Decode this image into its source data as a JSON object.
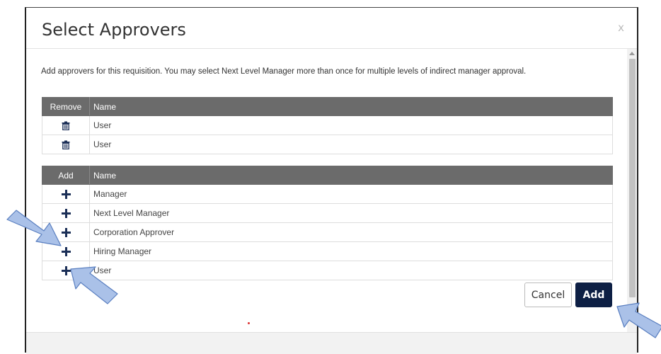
{
  "modal": {
    "title": "Select Approvers",
    "close_label": "x",
    "intro": "Add approvers for this requisition. You may select Next Level Manager more than once for multiple levels of indirect manager approval."
  },
  "selected_table": {
    "headers": [
      "Remove",
      "Name"
    ],
    "rows": [
      {
        "name": "User"
      },
      {
        "name": "User"
      }
    ]
  },
  "available_table": {
    "headers": [
      "Add",
      "Name"
    ],
    "rows": [
      {
        "name": "Manager"
      },
      {
        "name": "Next Level Manager"
      },
      {
        "name": "Corporation Approver"
      },
      {
        "name": "Hiring Manager"
      },
      {
        "name": "User"
      }
    ]
  },
  "buttons": {
    "cancel": "Cancel",
    "add": "Add"
  },
  "icons": {
    "remove": "trash-icon",
    "add": "plus-icon",
    "close": "close-icon"
  },
  "colors": {
    "header_bg": "#6b6b6b",
    "primary_button": "#0d1f44",
    "plus_icon": "#1b2f57",
    "annotation_arrow": "#a9bfe6"
  }
}
